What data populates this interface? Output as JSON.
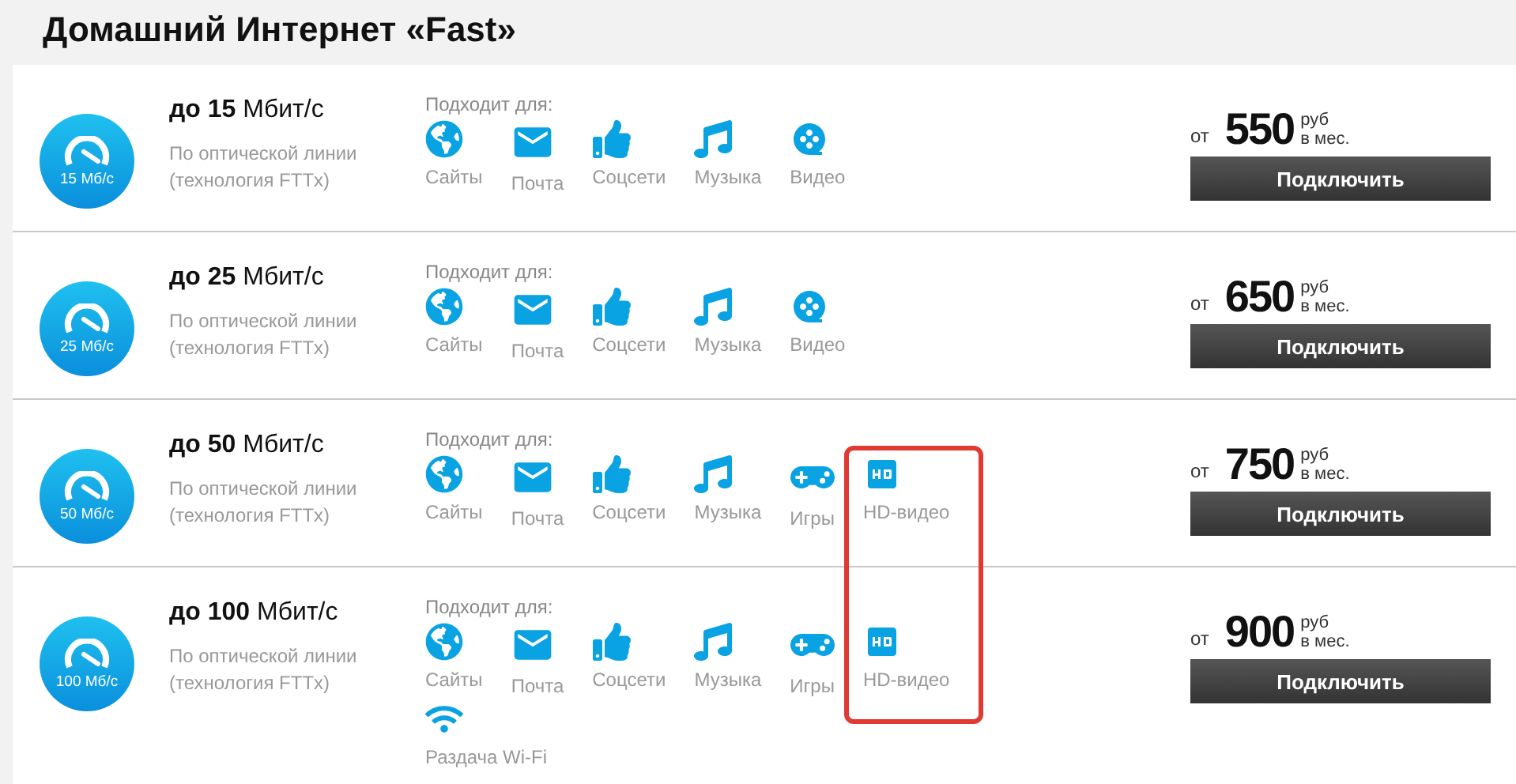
{
  "title": "Домашний Интернет «Fast»",
  "plans": [
    {
      "badge": "15 Мб/с",
      "speed": "**до 15** Мбит/с",
      "description": "По оптической линии (технология FTTx)",
      "features_label": "Подходит для:",
      "features": [
        {
          "kind": "globe",
          "label": "Сайты"
        },
        {
          "kind": "mail",
          "label": "Почта"
        },
        {
          "kind": "like",
          "label": "Соцсети"
        },
        {
          "kind": "music",
          "label": "Музыка"
        },
        {
          "kind": "video",
          "label": "Видео"
        }
      ],
      "price_prefix": "от",
      "price": "550",
      "currency": "руб",
      "period": "в мес.",
      "button": "Подключить"
    },
    {
      "badge": "25 Мб/с",
      "speed": "**до 25** Мбит/с",
      "description": "По оптической линии (технология FTTx)",
      "features_label": "Подходит для:",
      "features": [
        {
          "kind": "globe",
          "label": "Сайты"
        },
        {
          "kind": "mail",
          "label": "Почта"
        },
        {
          "kind": "like",
          "label": "Соцсети"
        },
        {
          "kind": "music",
          "label": "Музыка"
        },
        {
          "kind": "video",
          "label": "Видео"
        }
      ],
      "price_prefix": "от",
      "price": "650",
      "currency": "руб",
      "period": "в мес.",
      "button": "Подключить"
    },
    {
      "badge": "50 Мб/с",
      "speed": "**до 50** Мбит/с",
      "description": "По оптической линии (технология FTTx)",
      "features_label": "Подходит для:",
      "features": [
        {
          "kind": "globe",
          "label": "Сайты"
        },
        {
          "kind": "mail",
          "label": "Почта"
        },
        {
          "kind": "like",
          "label": "Соцсети"
        },
        {
          "kind": "music",
          "label": "Музыка"
        },
        {
          "kind": "game",
          "label": "Игры"
        },
        {
          "kind": "hd",
          "label": "HD-видео"
        }
      ],
      "price_prefix": "от",
      "price": "750",
      "currency": "руб",
      "period": "в мес.",
      "button": "Подключить"
    },
    {
      "badge": "100 Мб/с",
      "speed": "**до 100** Мбит/с",
      "description": "По оптической линии (технология FTTx)",
      "features_label": "Подходит для:",
      "features": [
        {
          "kind": "globe",
          "label": "Сайты"
        },
        {
          "kind": "mail",
          "label": "Почта"
        },
        {
          "kind": "like",
          "label": "Соцсети"
        },
        {
          "kind": "music",
          "label": "Музыка"
        },
        {
          "kind": "game",
          "label": "Игры"
        },
        {
          "kind": "hd",
          "label": "HD-видео"
        },
        {
          "kind": "wifi",
          "label": "Раздача Wi-Fi"
        }
      ],
      "price_prefix": "от",
      "price": "900",
      "currency": "руб",
      "period": "в мес.",
      "button": "Подключить"
    }
  ]
}
